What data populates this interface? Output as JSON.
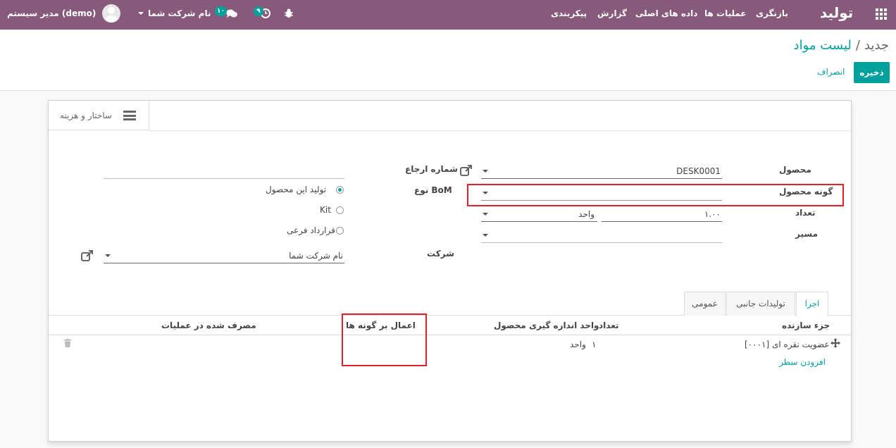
{
  "topbar": {
    "app_name": "تولید",
    "menu": [
      "بازنگری",
      "عملیات ها",
      "داده های اصلی",
      "گزارش",
      "پیکربندی"
    ],
    "company": "نام شرکت شما",
    "user": "مدیر سیستم (demo)",
    "messages_count": "۱۰",
    "activities_count": "۹",
    "bg_color": "#875a7b"
  },
  "breadcrumb": {
    "parent": "لیست مواد",
    "separator": "/",
    "current": "جدید"
  },
  "actions": {
    "save": "ذخیره",
    "discard": "انصراف"
  },
  "smart_button": {
    "label": "ساختار و هزینه",
    "icon": "list-icon"
  },
  "form": {
    "product_label": "محصول",
    "product_value": "DESK0001",
    "variant_label": "گونه محصول",
    "variant_value": "",
    "quantity_label": "تعداد",
    "quantity_value": "۱.۰۰",
    "uom_value": "واحد",
    "route_label": "مسیر",
    "route_value": "",
    "reference_label": "شماره ارجاع",
    "reference_value": "",
    "bom_type_label": "نوع BoM",
    "bom_types": [
      {
        "label": "تولید این محصول",
        "selected": true
      },
      {
        "label": "Kit",
        "selected": false
      },
      {
        "label": "قرارداد فرعی",
        "selected": false
      }
    ],
    "company_label": "شرکت",
    "company_value": "نام شرکت شما"
  },
  "tabs": [
    "اجزا",
    "تولیدات جانبی",
    "عمومی"
  ],
  "table": {
    "headers": [
      "جزء سازنده",
      "تعداد",
      "واحد اندازه گیری محصول",
      "اعمال بر گونه ها",
      "مصرف شده در عملیات"
    ],
    "rows": [
      {
        "component": "[۰۰۰۱] عضویت نقره ای",
        "quantity": "۱",
        "uom": "واحد",
        "variants": "",
        "operation": ""
      }
    ],
    "add_line": "افزودن سطر"
  }
}
